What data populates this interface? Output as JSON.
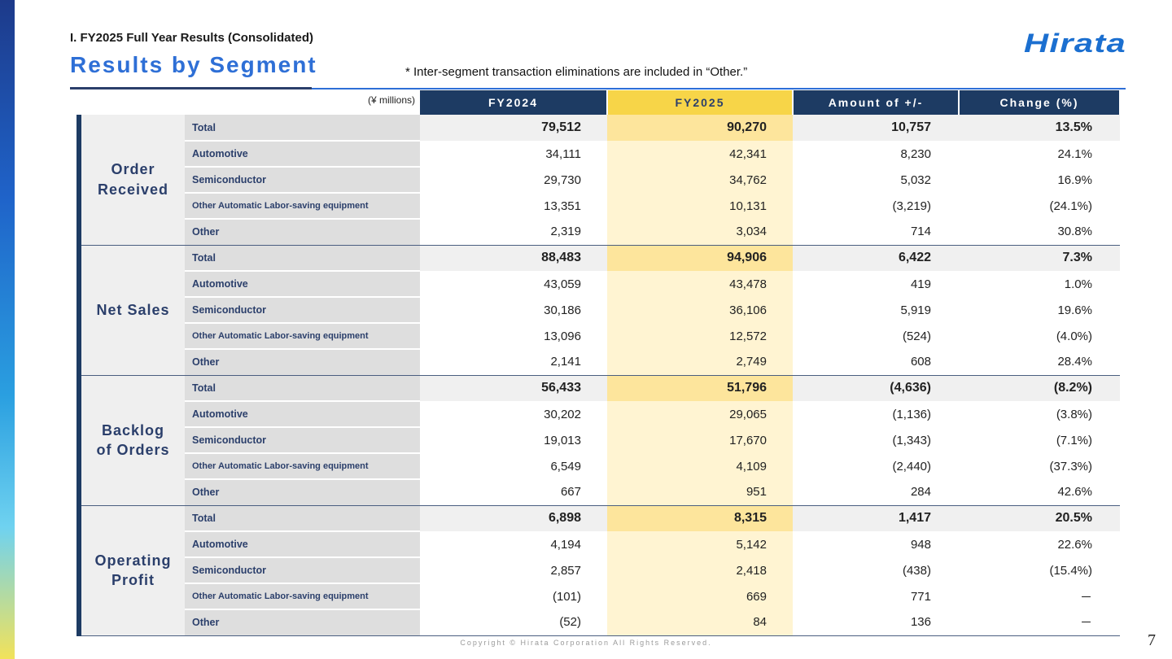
{
  "section_label": "I. FY2025 Full Year Results (Consolidated)",
  "page_title": "Results by Segment",
  "note": "* Inter-segment transaction eliminations are included in “Other.”",
  "logo_text": "Hirata",
  "units": "(¥ millions)",
  "columns": [
    "FY2024",
    "FY2025",
    "Amount of +/-",
    "Change (%)"
  ],
  "groups": [
    {
      "name_lines": [
        "Order",
        "Received"
      ],
      "rows": [
        {
          "label": "Total",
          "fy2024": "79,512",
          "fy2025": "90,270",
          "amount": "10,757",
          "change": "13.5%"
        },
        {
          "label": "Automotive",
          "fy2024": "34,111",
          "fy2025": "42,341",
          "amount": "8,230",
          "change": "24.1%"
        },
        {
          "label": "Semiconductor",
          "fy2024": "29,730",
          "fy2025": "34,762",
          "amount": "5,032",
          "change": "16.9%"
        },
        {
          "label": "Other Automatic Labor-saving equipment",
          "fy2024": "13,351",
          "fy2025": "10,131",
          "amount": "(3,219)",
          "change": "(24.1%)"
        },
        {
          "label": "Other",
          "fy2024": "2,319",
          "fy2025": "3,034",
          "amount": "714",
          "change": "30.8%"
        }
      ]
    },
    {
      "name_lines": [
        "Net Sales"
      ],
      "rows": [
        {
          "label": "Total",
          "fy2024": "88,483",
          "fy2025": "94,906",
          "amount": "6,422",
          "change": "7.3%"
        },
        {
          "label": "Automotive",
          "fy2024": "43,059",
          "fy2025": "43,478",
          "amount": "419",
          "change": "1.0%"
        },
        {
          "label": "Semiconductor",
          "fy2024": "30,186",
          "fy2025": "36,106",
          "amount": "5,919",
          "change": "19.6%"
        },
        {
          "label": "Other Automatic Labor-saving equipment",
          "fy2024": "13,096",
          "fy2025": "12,572",
          "amount": "(524)",
          "change": "(4.0%)"
        },
        {
          "label": "Other",
          "fy2024": "2,141",
          "fy2025": "2,749",
          "amount": "608",
          "change": "28.4%"
        }
      ]
    },
    {
      "name_lines": [
        "Backlog",
        "of Orders"
      ],
      "rows": [
        {
          "label": "Total",
          "fy2024": "56,433",
          "fy2025": "51,796",
          "amount": "(4,636)",
          "change": "(8.2%)"
        },
        {
          "label": "Automotive",
          "fy2024": "30,202",
          "fy2025": "29,065",
          "amount": "(1,136)",
          "change": "(3.8%)"
        },
        {
          "label": "Semiconductor",
          "fy2024": "19,013",
          "fy2025": "17,670",
          "amount": "(1,343)",
          "change": "(7.1%)"
        },
        {
          "label": "Other Automatic Labor-saving equipment",
          "fy2024": "6,549",
          "fy2025": "4,109",
          "amount": "(2,440)",
          "change": "(37.3%)"
        },
        {
          "label": "Other",
          "fy2024": "667",
          "fy2025": "951",
          "amount": "284",
          "change": "42.6%"
        }
      ]
    },
    {
      "name_lines": [
        "Operating",
        "Profit"
      ],
      "rows": [
        {
          "label": "Total",
          "fy2024": "6,898",
          "fy2025": "8,315",
          "amount": "1,417",
          "change": "20.5%"
        },
        {
          "label": "Automotive",
          "fy2024": "4,194",
          "fy2025": "5,142",
          "amount": "948",
          "change": "22.6%"
        },
        {
          "label": "Semiconductor",
          "fy2024": "2,857",
          "fy2025": "2,418",
          "amount": "(438)",
          "change": "(15.4%)"
        },
        {
          "label": "Other Automatic Labor-saving equipment",
          "fy2024": "(101)",
          "fy2025": "669",
          "amount": "771",
          "change": "－"
        },
        {
          "label": "Other",
          "fy2024": "(52)",
          "fy2025": "84",
          "amount": "136",
          "change": "－"
        }
      ]
    }
  ],
  "copyright": "Copyright © Hirata Corporation All Rights Reserved.",
  "page_number": "7",
  "colors": {
    "navy": "#1d3b63",
    "title_blue": "#2e6fd6",
    "fy2025_header": "#f7d548",
    "fy2025_total": "#fde59c",
    "fy2025_cell": "#fff4d2"
  }
}
